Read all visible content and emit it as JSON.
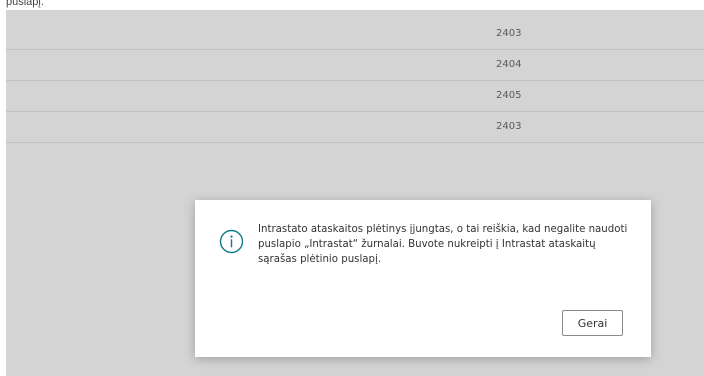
{
  "top_strip": {
    "text": "puslapį."
  },
  "grid": {
    "rows": [
      {
        "value": "2403"
      },
      {
        "value": "2404"
      },
      {
        "value": "2405"
      },
      {
        "value": "2403"
      }
    ]
  },
  "dialog": {
    "icon": "info-icon",
    "message": "Intrastato ataskaitos plėtinys įjungtas, o tai reiškia, kad negalite naudoti puslapio „Intrastat“ žurnalai. Buvote nukreipti į Intrastat ataskaitų sąrašas plėtinio puslapį.",
    "ok_label": "Gerai"
  },
  "colors": {
    "accent": "#0f7b8a",
    "overlay": "#d4d4d4"
  }
}
